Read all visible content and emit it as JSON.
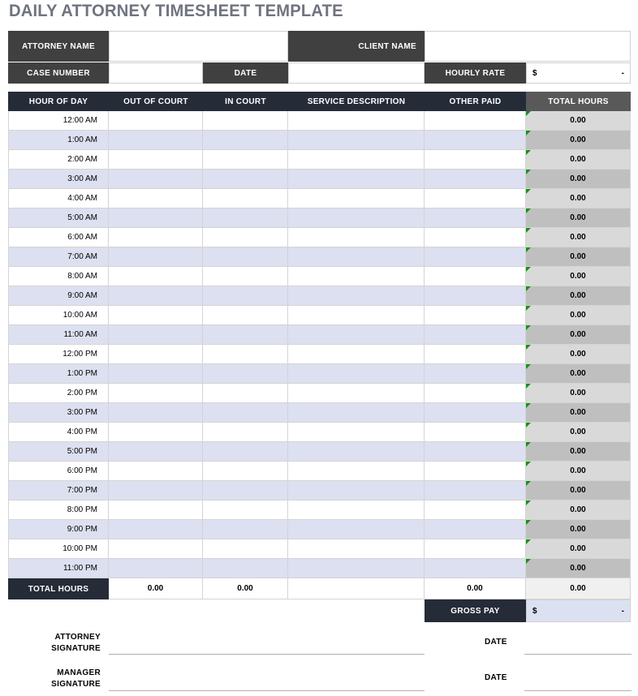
{
  "title": "DAILY ATTORNEY TIMESHEET TEMPLATE",
  "info": {
    "attorney_name_label": "ATTORNEY NAME",
    "attorney_name_value": "",
    "client_name_label": "CLIENT NAME",
    "client_name_value": "",
    "case_number_label": "CASE NUMBER",
    "case_number_value": "",
    "date_label": "DATE",
    "date_value": "",
    "hourly_rate_label": "HOURLY RATE",
    "hourly_rate_currency": "$",
    "hourly_rate_value": "-"
  },
  "table": {
    "columns": [
      "HOUR OF DAY",
      "OUT OF COURT",
      "IN COURT",
      "SERVICE DESCRIPTION",
      "OTHER PAID",
      "TOTAL HOURS"
    ],
    "rows": [
      {
        "hour": "12:00 AM",
        "out_of_court": "",
        "in_court": "",
        "service_description": "",
        "other_paid": "",
        "total_hours": "0.00"
      },
      {
        "hour": "1:00 AM",
        "out_of_court": "",
        "in_court": "",
        "service_description": "",
        "other_paid": "",
        "total_hours": "0.00"
      },
      {
        "hour": "2:00 AM",
        "out_of_court": "",
        "in_court": "",
        "service_description": "",
        "other_paid": "",
        "total_hours": "0.00"
      },
      {
        "hour": "3:00 AM",
        "out_of_court": "",
        "in_court": "",
        "service_description": "",
        "other_paid": "",
        "total_hours": "0.00"
      },
      {
        "hour": "4:00 AM",
        "out_of_court": "",
        "in_court": "",
        "service_description": "",
        "other_paid": "",
        "total_hours": "0.00"
      },
      {
        "hour": "5:00 AM",
        "out_of_court": "",
        "in_court": "",
        "service_description": "",
        "other_paid": "",
        "total_hours": "0.00"
      },
      {
        "hour": "6:00 AM",
        "out_of_court": "",
        "in_court": "",
        "service_description": "",
        "other_paid": "",
        "total_hours": "0.00"
      },
      {
        "hour": "7:00 AM",
        "out_of_court": "",
        "in_court": "",
        "service_description": "",
        "other_paid": "",
        "total_hours": "0.00"
      },
      {
        "hour": "8:00 AM",
        "out_of_court": "",
        "in_court": "",
        "service_description": "",
        "other_paid": "",
        "total_hours": "0.00"
      },
      {
        "hour": "9:00 AM",
        "out_of_court": "",
        "in_court": "",
        "service_description": "",
        "other_paid": "",
        "total_hours": "0.00"
      },
      {
        "hour": "10:00 AM",
        "out_of_court": "",
        "in_court": "",
        "service_description": "",
        "other_paid": "",
        "total_hours": "0.00"
      },
      {
        "hour": "11:00 AM",
        "out_of_court": "",
        "in_court": "",
        "service_description": "",
        "other_paid": "",
        "total_hours": "0.00"
      },
      {
        "hour": "12:00 PM",
        "out_of_court": "",
        "in_court": "",
        "service_description": "",
        "other_paid": "",
        "total_hours": "0.00"
      },
      {
        "hour": "1:00 PM",
        "out_of_court": "",
        "in_court": "",
        "service_description": "",
        "other_paid": "",
        "total_hours": "0.00"
      },
      {
        "hour": "2:00 PM",
        "out_of_court": "",
        "in_court": "",
        "service_description": "",
        "other_paid": "",
        "total_hours": "0.00"
      },
      {
        "hour": "3:00 PM",
        "out_of_court": "",
        "in_court": "",
        "service_description": "",
        "other_paid": "",
        "total_hours": "0.00"
      },
      {
        "hour": "4:00 PM",
        "out_of_court": "",
        "in_court": "",
        "service_description": "",
        "other_paid": "",
        "total_hours": "0.00"
      },
      {
        "hour": "5:00 PM",
        "out_of_court": "",
        "in_court": "",
        "service_description": "",
        "other_paid": "",
        "total_hours": "0.00"
      },
      {
        "hour": "6:00 PM",
        "out_of_court": "",
        "in_court": "",
        "service_description": "",
        "other_paid": "",
        "total_hours": "0.00"
      },
      {
        "hour": "7:00 PM",
        "out_of_court": "",
        "in_court": "",
        "service_description": "",
        "other_paid": "",
        "total_hours": "0.00"
      },
      {
        "hour": "8:00 PM",
        "out_of_court": "",
        "in_court": "",
        "service_description": "",
        "other_paid": "",
        "total_hours": "0.00"
      },
      {
        "hour": "9:00 PM",
        "out_of_court": "",
        "in_court": "",
        "service_description": "",
        "other_paid": "",
        "total_hours": "0.00"
      },
      {
        "hour": "10:00 PM",
        "out_of_court": "",
        "in_court": "",
        "service_description": "",
        "other_paid": "",
        "total_hours": "0.00"
      },
      {
        "hour": "11:00 PM",
        "out_of_court": "",
        "in_court": "",
        "service_description": "",
        "other_paid": "",
        "total_hours": "0.00"
      }
    ],
    "footer": {
      "label": "TOTAL HOURS",
      "out_of_court_total": "0.00",
      "in_court_total": "0.00",
      "service_description_total": "",
      "other_paid_total": "0.00",
      "total_hours_total": "0.00"
    }
  },
  "gross_pay": {
    "label": "GROSS PAY",
    "currency": "$",
    "value": "-"
  },
  "signatures": {
    "attorney_label_line1": "ATTORNEY",
    "attorney_label_line2": "SIGNATURE",
    "manager_label_line1": "MANAGER",
    "manager_label_line2": "SIGNATURE",
    "attorney_date_label": "DATE",
    "manager_date_label": "DATE",
    "attorney_signature_value": "",
    "manager_signature_value": "",
    "attorney_date_value": "",
    "manager_date_value": ""
  },
  "colors": {
    "title": "#6f747f",
    "header_dark": "#404040",
    "table_header": "#262b38",
    "total_hours_header": "#595959",
    "row_alt": "#dce0f0",
    "total_col_odd": "#d9d9d9",
    "total_col_even": "#bfbfbf",
    "gross_pay_field": "#dce1f2",
    "flag_green": "#149414"
  }
}
